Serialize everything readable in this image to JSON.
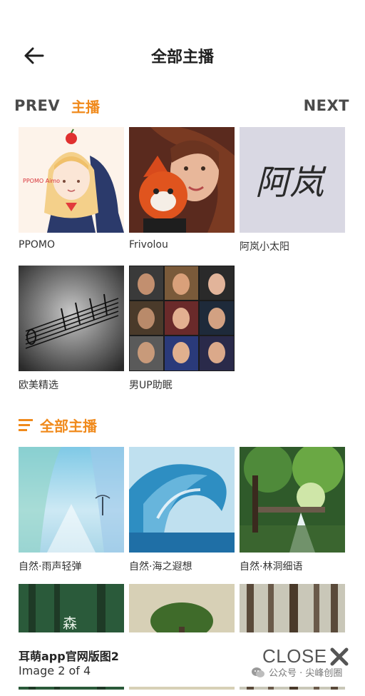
{
  "header": {
    "title": "全部主播"
  },
  "nav": {
    "prev": "PREV",
    "tab": "主播",
    "next": "NEXT"
  },
  "featured": [
    {
      "label": "PPOMO",
      "art_text": "PPOMO Aimo"
    },
    {
      "label": "Frivolou"
    },
    {
      "label": "阿岚小太阳",
      "art_text": "阿岚"
    },
    {
      "label": "欧美精选"
    },
    {
      "label": "男UP助眠"
    }
  ],
  "section": {
    "label": "全部主播"
  },
  "all": [
    {
      "label": "自然·雨声轻弹"
    },
    {
      "label": "自然·海之遐想"
    },
    {
      "label": "自然·林洞细语"
    },
    {
      "label": "",
      "art_text": "森"
    },
    {
      "label": ""
    },
    {
      "label": ""
    }
  ],
  "caption": {
    "title": "耳萌app官网版图2",
    "subtitle": "Image 2 of 4"
  },
  "close": {
    "label": "CLOSE"
  },
  "watermark": {
    "text": "公众号 · 尖峰创圈"
  },
  "colors": {
    "accent": "#f08a1c",
    "text": "#333333"
  },
  "icons": [
    "back-arrow-icon",
    "menu-lines-icon",
    "close-x-icon",
    "wechat-icon"
  ]
}
